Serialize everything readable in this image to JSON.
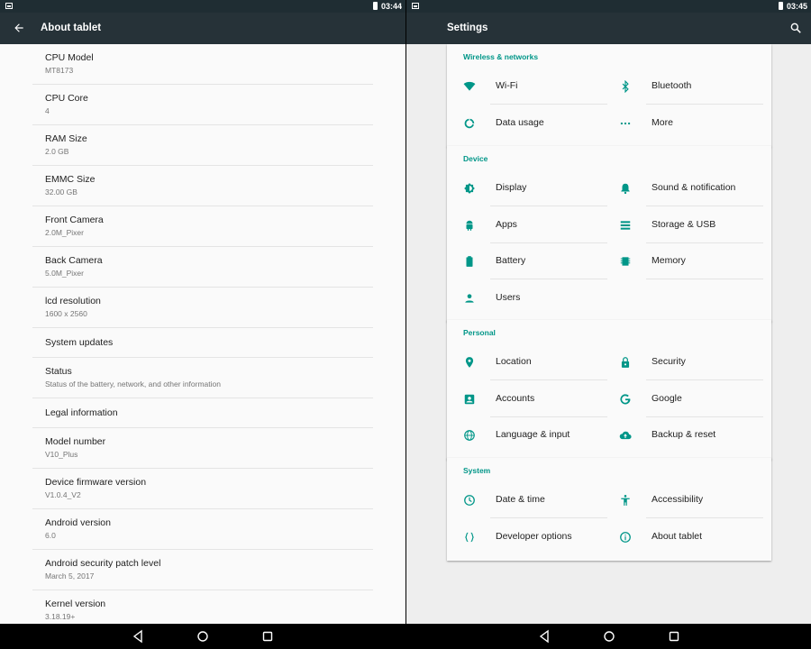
{
  "left": {
    "status_time": "03:44",
    "title": "About tablet",
    "items": [
      {
        "title": "CPU Model",
        "subtitle": "MT8173"
      },
      {
        "title": "CPU Core",
        "subtitle": "4"
      },
      {
        "title": "RAM Size",
        "subtitle": "2.0 GB"
      },
      {
        "title": "EMMC Size",
        "subtitle": "32.00 GB"
      },
      {
        "title": "Front Camera",
        "subtitle": "2.0M_Pixer"
      },
      {
        "title": "Back Camera",
        "subtitle": "5.0M_Pixer"
      },
      {
        "title": "lcd resolution",
        "subtitle": "1600 x 2560"
      },
      {
        "title": "System updates",
        "subtitle": ""
      },
      {
        "title": "Status",
        "subtitle": "Status of the battery, network, and other information"
      },
      {
        "title": "Legal information",
        "subtitle": ""
      },
      {
        "title": "Model number",
        "subtitle": "V10_Plus"
      },
      {
        "title": "Device firmware version",
        "subtitle": "V1.0.4_V2"
      },
      {
        "title": "Android version",
        "subtitle": "6.0"
      },
      {
        "title": "Android security patch level",
        "subtitle": "March 5, 2017"
      },
      {
        "title": "Kernel version",
        "subtitle": "3.18.19+"
      }
    ]
  },
  "right": {
    "status_time": "03:45",
    "title": "Settings",
    "sections": [
      {
        "category": "Wireless & networks",
        "items": [
          {
            "label": "Wi-Fi",
            "icon": "wifi-icon"
          },
          {
            "label": "Bluetooth",
            "icon": "bluetooth-icon"
          },
          {
            "label": "Data usage",
            "icon": "data-usage-icon"
          },
          {
            "label": "More",
            "icon": "more-icon"
          }
        ]
      },
      {
        "category": "Device",
        "items": [
          {
            "label": "Display",
            "icon": "display-icon"
          },
          {
            "label": "Sound & notification",
            "icon": "bell-icon"
          },
          {
            "label": "Apps",
            "icon": "android-icon"
          },
          {
            "label": "Storage & USB",
            "icon": "storage-icon"
          },
          {
            "label": "Battery",
            "icon": "battery-icon"
          },
          {
            "label": "Memory",
            "icon": "memory-icon"
          },
          {
            "label": "Users",
            "icon": "person-icon"
          }
        ]
      },
      {
        "category": "Personal",
        "items": [
          {
            "label": "Location",
            "icon": "location-icon"
          },
          {
            "label": "Security",
            "icon": "lock-icon"
          },
          {
            "label": "Accounts",
            "icon": "account-icon"
          },
          {
            "label": "Google",
            "icon": "google-icon"
          },
          {
            "label": "Language & input",
            "icon": "globe-icon"
          },
          {
            "label": "Backup & reset",
            "icon": "cloud-upload-icon"
          }
        ]
      },
      {
        "category": "System",
        "items": [
          {
            "label": "Date & time",
            "icon": "clock-icon"
          },
          {
            "label": "Accessibility",
            "icon": "accessibility-icon"
          },
          {
            "label": "Developer options",
            "icon": "braces-icon"
          },
          {
            "label": "About tablet",
            "icon": "info-icon"
          }
        ]
      }
    ]
  },
  "colors": {
    "accent": "#009688",
    "toolbar": "#263238",
    "statusbar": "#1f2d33"
  }
}
